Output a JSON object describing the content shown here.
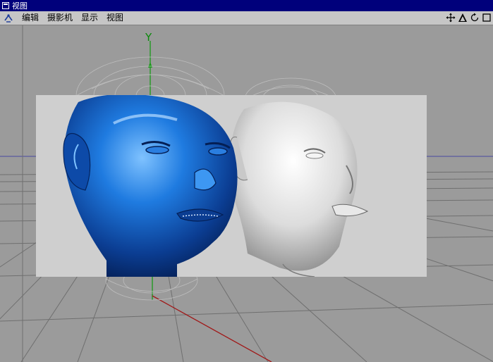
{
  "window": {
    "title": "视图"
  },
  "menu": {
    "items": [
      "编辑",
      "摄影机",
      "显示",
      "视图"
    ]
  },
  "toolbar": {
    "icons": [
      "move-icon",
      "zoom-icon",
      "rotate-icon",
      "maximize-icon"
    ]
  },
  "viewport": {
    "axis_y_label": "Y"
  },
  "colors": {
    "titlebar": "#00007b",
    "menubar": "#c6c6c6",
    "viewport_bg": "#9b9b9b",
    "grid": "#7a7a7a",
    "blue_head": "#1f6fd6",
    "white_head": "#e6e6e6",
    "y_axis": "#1a9a1a",
    "x_axis": "#9a1a1a"
  }
}
